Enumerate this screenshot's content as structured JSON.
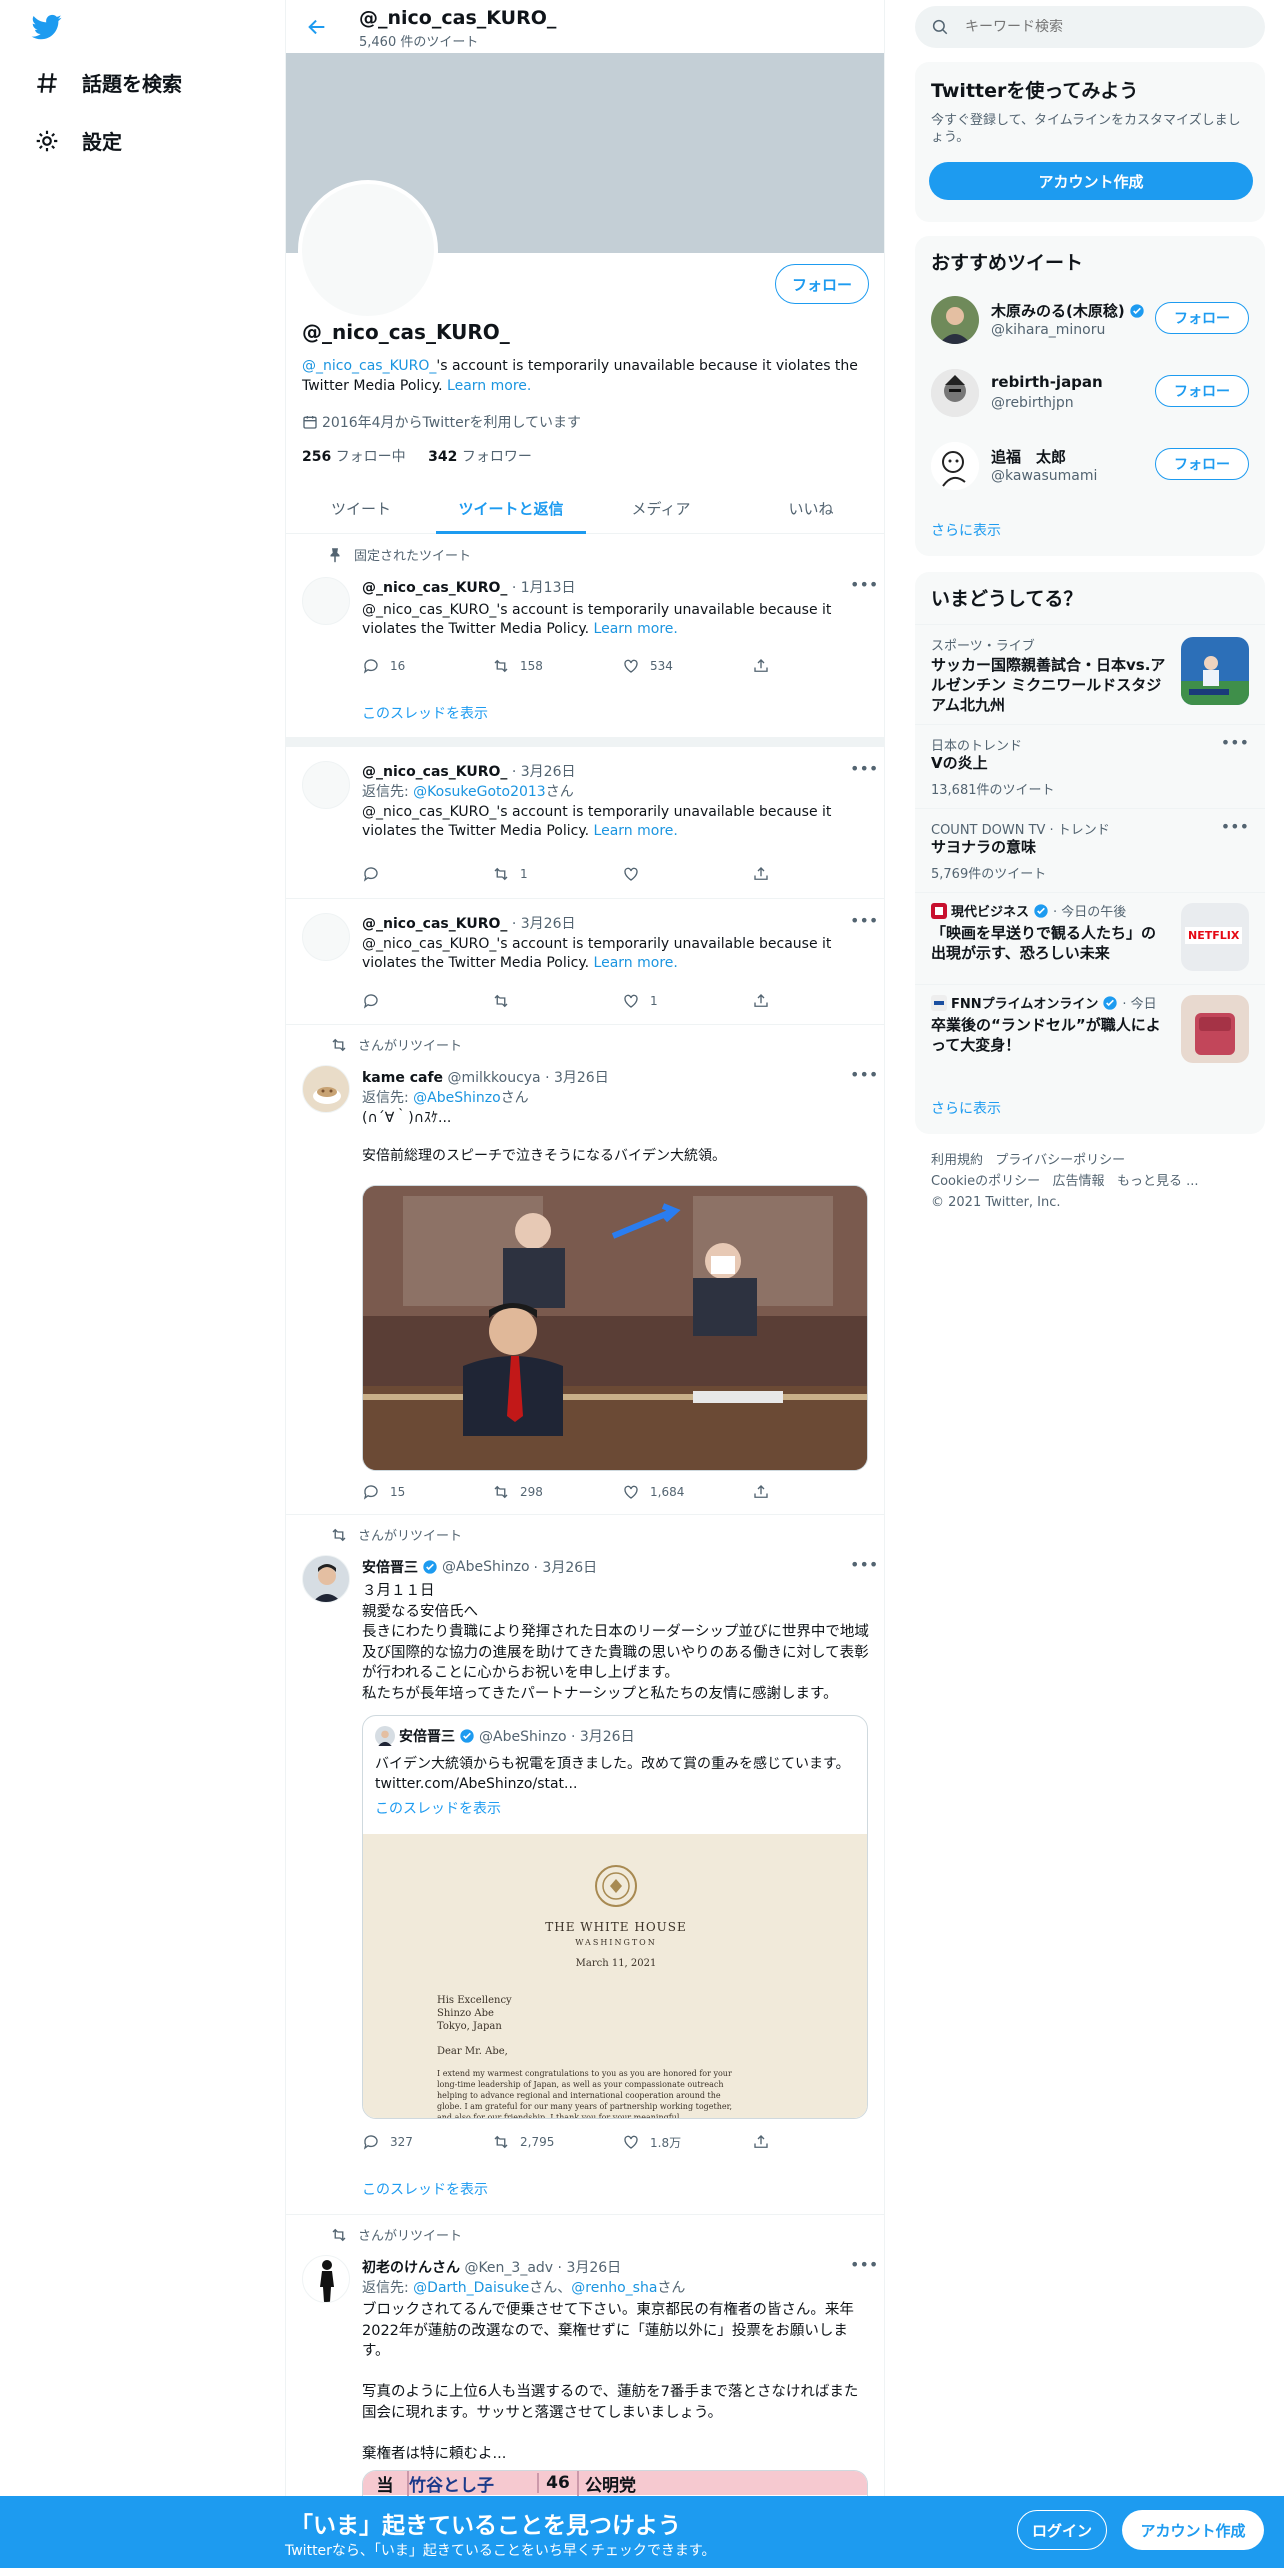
{
  "nav": {
    "explore": "話題を検索",
    "settings": "設定"
  },
  "profile": {
    "top_name": "@_nico_cas_KURO_",
    "tweet_count": "5,460 件のツイート",
    "follow_label": "フォロー",
    "name": "@_nico_cas_KURO_",
    "bio_handle": "@_nico_cas_KURO_",
    "bio_text": "'s account is temporarily unavailable because it violates the Twitter Media Policy. ",
    "bio_learn": "Learn more.",
    "joined": "2016年4月からTwitterを利用しています",
    "following_count": "256",
    "following_label": "フォロー中",
    "followers_count": "342",
    "followers_label": "フォロワー"
  },
  "tabs": [
    "ツイート",
    "ツイートと返信",
    "メディア",
    "いいね"
  ],
  "tweets": [
    {
      "context": "固定されたツイート",
      "handle": "@_nico_cas_KURO_",
      "date": "· 1月13日",
      "text": "@_nico_cas_KURO_'s account is temporarily unavailable because it violates the Twitter Media Policy. ",
      "learn": "Learn more.",
      "replies": "16",
      "retweets": "158",
      "likes": "534",
      "thread": "このスレッドを表示"
    },
    {
      "handle": "@_nico_cas_KURO_",
      "date": "· 3月26日",
      "reply_prefix": "返信先: ",
      "reply_to": "@KosukeGoto2013",
      "reply_suffix": "さん",
      "text": "@_nico_cas_KURO_'s account is temporarily unavailable because it violates the Twitter Media Policy. ",
      "learn": "Learn more.",
      "replies": "",
      "retweets": "1",
      "likes": ""
    },
    {
      "handle": "@_nico_cas_KURO_",
      "date": "· 3月26日",
      "text": "@_nico_cas_KURO_'s account is temporarily unavailable because it violates the Twitter Media Policy. ",
      "learn": "Learn more.",
      "replies": "",
      "retweets": "",
      "likes": "1"
    },
    {
      "context": "さんがリツイート",
      "name": "kame cafe",
      "handle": "@milkkoucya",
      "date": "· 3月26日",
      "reply_prefix": "返信先: ",
      "reply_to": "@AbeShinzo",
      "reply_suffix": "さん",
      "text": "(∩´∀｀)∩ｽｹ...\n\n安倍前総理のスピーチで泣きそうになるバイデン大統領。",
      "replies": "15",
      "retweets": "298",
      "likes": "1,684"
    },
    {
      "context": "さんがリツイート",
      "name": "安倍晋三",
      "handle": "@AbeShinzo",
      "date": "· 3月26日",
      "text": "３月１１日\n親愛なる安倍氏へ\n長きにわたり貴職により発揮された日本のリーダーシップ並びに世界中で地域及び国際的な協力の進展を助けてきた貴職の思いやりのある働きに対して表彰が行われることに心からお祝いを申し上げます。\n私たちが長年培ってきたパートナーシップと私たちの友情に感謝します。",
      "quote_name": "安倍晋三",
      "quote_handle": "@AbeShinzo · 3月26日",
      "quote_text": "バイデン大統領からも祝電を頂きました。改めて賞の重みを感じています。 twitter.com/AbeShinzo/stat...",
      "quote_thread": "このスレッドを表示",
      "letter_head": "THE WHITE HOUSE",
      "letter_city": "WASHINGTON",
      "letter_date": "March 11, 2021",
      "letter_addr": "His Excellency\nShinzo Abe\nTokyo, Japan",
      "letter_dear": "Dear Mr. Abe,",
      "letter_body": "I extend my warmest congratulations to you as you are honored for your\nlong-time leadership of Japan, as well as your compassionate outreach\nhelping to advance regional and international cooperation around the\nglobe. I am grateful for our many years of partnership working together,\nand also for our friendship. I thank you for your meaningful",
      "replies": "327",
      "retweets": "2,795",
      "likes": "1.8万",
      "thread": "このスレッドを表示"
    },
    {
      "context": "さんがリツイート",
      "name": "初老のけんさん",
      "handle": "@Ken_3_adv",
      "date": "· 3月26日",
      "reply_prefix": "返信先: ",
      "reply_to": "@Darth_Daisuke",
      "reply_mid": "さん、",
      "reply_to2": "@renho_sha",
      "reply_suffix": "さん",
      "text": "ブロックされてるんで便乗させて下さい。東京都民の有権者の皆さん。来年2022年が蓮舫の改選なので、棄権せずに「蓮舫以外に」投票をお願いします。\n\n写真のように上位6人も当選するので、蓮舫を7番手まで落とさなければまた国会に現れます。サッサと落選させてしまいましょう。\n\n棄権者は特に頼むよ...",
      "poster_mark": "当",
      "poster_name": "竹谷とし子",
      "poster_num": "46",
      "poster_party": "公明党"
    }
  ],
  "right": {
    "search_placeholder": "キーワード検索",
    "signup_title": "Twitterを使ってみよう",
    "signup_sub": "今すぐ登録して、タイムラインをカスタマイズしましょう。",
    "signup_button": "アカウント作成",
    "recs_title": "おすすめツイート",
    "recs": [
      {
        "name": "木原みのる(木原稔)",
        "handle": "@kihara_minoru",
        "verified": true
      },
      {
        "name": "rebirth-japan",
        "handle": "@rebirthjpn",
        "verified": false
      },
      {
        "name": "追福　太郎",
        "handle": "@kawasumami",
        "verified": false
      }
    ],
    "follow_label": "フォロー",
    "show_more": "さらに表示",
    "trends_title": "いまどうしてる？",
    "trends": [
      {
        "cat": "スポーツ・ライブ",
        "name": "サッカー国際親善試合・日本vs.アルゼンチン ミクニワールドスタジアム北九州"
      },
      {
        "cat": "日本のトレンド",
        "name": "Vの炎上",
        "count": "13,681件のツイート"
      },
      {
        "cat": "COUNT DOWN TV · トレンド",
        "name": "サヨナラの意味",
        "count": "5,769件のツイート"
      },
      {
        "source": "現代ビジネス",
        "time": "· 今日の午後",
        "name": "「映画を早送りで観る人たち」の出現が示す、恐ろしい未来",
        "img_text": "NETFLIX"
      },
      {
        "source": "FNNプライムオンライン",
        "time": "· 今日",
        "name": "卒業後の“ランドセル”が職人によって大変身！"
      }
    ],
    "trends_more": "さらに表示",
    "footer": {
      "terms": "利用規約",
      "privacy": "プライバシーポリシー",
      "cookie": "Cookieのポリシー",
      "ads": "広告情報",
      "more": "もっと見る ...",
      "copyright": "© 2021 Twitter, Inc."
    }
  },
  "bottom": {
    "title": "「いま」起きていることを見つけよう",
    "sub": "Twitterなら、「いま」起きていることをいち早くチェックできます。",
    "login": "ログイン",
    "signup": "アカウント作成"
  },
  "colors": {
    "accent": "#1d9bf0",
    "banner": "#c4cfd6",
    "text": "#0f1419",
    "muted": "#536471"
  }
}
